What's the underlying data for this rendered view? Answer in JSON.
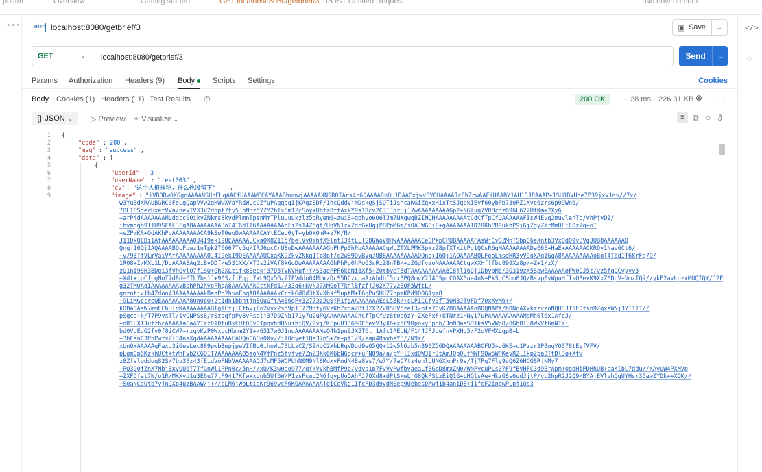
{
  "app": {
    "tab_strip": [
      "postm",
      "Overview",
      "Getting started",
      "GET localhost:8080/getbrief/3",
      "POST Untitled Request",
      "No environment"
    ]
  },
  "request": {
    "badge": "HTTP",
    "title": "localhost:8080/getbrief/3",
    "save_label": "Save",
    "method": "GET",
    "url": "localhost:8080/getbrief/3",
    "send_label": "Send"
  },
  "request_tabs": {
    "params": "Params",
    "authorization": "Authorization",
    "headers": "Headers (9)",
    "body": "Body",
    "scripts": "Scripts",
    "settings": "Settings",
    "cookies": "Cookies"
  },
  "response_tabs": {
    "body": "Body",
    "cookies": "Cookies (1)",
    "headers": "Headers (11)",
    "test_results": "Test Results"
  },
  "response_meta": {
    "status": "200 OK",
    "time": "28 ms",
    "size": "226.31 KB"
  },
  "format_bar": {
    "format": "JSON",
    "preview": "Preview",
    "visualize": "Visualize"
  },
  "icons": {
    "left_menu": "more-dots-icon",
    "right_code": "code-icon",
    "right_bulb": "lightbulb-icon",
    "history": "history-icon",
    "globe": "globe-icon",
    "wrap": "wrap-lines-icon",
    "copy": "copy-icon",
    "search": "search-icon",
    "link": "link-icon"
  },
  "colors": {
    "accent": "#2871d4",
    "method_get": "#0b7a3e",
    "status_ok_bg": "#e4f3e7",
    "json_key": "#b0382f",
    "json_value": "#0b5fb8"
  },
  "code": {
    "line_numbers": [
      "1",
      "2",
      "3",
      "4",
      "5",
      "6",
      "7",
      "8",
      "9"
    ],
    "l1": "{",
    "l2_key": "\"code\"",
    "l2_val": "200",
    "l3_key": "\"msg\"",
    "l3_val": "\"success\"",
    "l4_key": "\"data\"",
    "l4_open": "[",
    "l5": "{",
    "l6_key": "\"userId\"",
    "l6_val": "3",
    "l7_key": "\"userName\"",
    "l7_val": "\"test003\"",
    "l8_key": "\"cv\"",
    "l8_val": "\"这个人很神秘，什么也没留下\"",
    "l9_key": "\"image\"",
    "l9_first": "\"iVBORw0KGgoAAAANSUhEUgAACfUAAAWECAYAAABhunwjAAAAAXNSR0IArs4c6QAAAARnQU1BAACxjwv8YQUAAAAJcEhZcwAAFiUAABY1AU1SJPAAAP+1SURBVHhe7P39jxV1nv//7x/",
    "image_lines": [
      "w3YuBdXRAUBGRC0FoLgQapVVw2gHWwXVaYRdWUcCZfuPAggsqIjKAgzSDF/1hcQddVjNDskQSjSQTiJshcaKGiZgxxHixTtSJgbkIEyf60ybPb730RZ1Xvc6zrs6p09Wn6/",
      "7DLTPSderUxetVVa/neVTVX3V2dopt7ty5JbNnz5YZM2bIxEmTZcSoy+Ubfz8tfAxkY9s1Rcv2CJTJqzHj17wAAAAAAAAAGp2+NGluq7V08coz696L622HfKm+2Xy6",
      "+arP4dAAAAAAAMLddcc00ikyZNkms8kydPlmnTpsnMmTPluuuukzlz5pRyem6+zwiE+qphvo6O6TJm7NXqwgBZINQHAAAAAAAAAtCdCfTpCfQAAAAAAFIsW4Evq2muvlenTp/vhPjvDZ/",
      "ihvmqgb9I1U9SFALJEqA8AAAAAAAABoT4T6dIT6AAAAAAAAoFi2s14Z5gt/UqVN1zxZdcG+UqjPBPpM6m/s0AJWGBiE+gAAAAAAAID2RKhPR9ukhP9j6jZgyZYrMmDEjEOz7q+oT",
      "+sZPmKR+OdAKhPoAAAAAAAACA9kSoT0eoDwAAAAACAYtECeo0yT+ybOXOmR+z7K/N/",
      "J11DkQEDi1AfAAAAAAAAA0J4I9ek19QEAAAAAUCxaOK8Z1157belVv0YhfX9lntI34tLLlS8GWoVQHwAAAAAAACeCPXpCPUBAAAAAFAsWjCvGZMnTSbp06eXntb3Vx0d09vBVqJUB8AAAAAAD",
      "Qngj16Qj1AQAAAABQLFowz1nTpk2T6667Tv5q/IRJ6pcCrUSoDwAAAAAAAAGhPhPp0hPoAAAAAACgWLZTXLPMK3pkzZ8pfXTxitPq1QCsR6gMAAAAAAAADaE6E+HaE+AAAAAACKRQv1Nav6Ct6/",
      "+v/93TfVLmVaiVAfAAAAAAAAA0J4I9ekI9QEAAAAAUCxaKK9ZkyZNkq1Tp8pf/c2wS9QvBVqJUB8AAAAAAAAADQngj16Qj1AQAAAABQLFooLmsdHR3yV9oXAq1GqA8AAAAAAAAAoBoT4T6dIT68rFq7Q/",
      "1R08+I/MXL1L/DgAAAABAq2iBvDDf/e531XX/XTJs2iVAf8kGoDwAAAAAAAAGhPhPp0hPoG3sRzZ8nTB/+zZGdfvzoNAAAAAACtqwXXHfffbc899Xz8p/+Z+1/zX/",
      "zU1nI9SH3BDqi3fVhGvlO7f1SO+Gh2XLtifk8Seekj37D5YVKVHuf+Y/S3aePPP6kbNi8Xf5+Z0tbyeT8dTAAAAAAAAAABI8jl16Qj1DbypM6/3Q319zX5SpwEAAAAAoFW0QJ5t/vz5fqQCvyvy3",
      "+Xdt+ipCfcgNoT7dRd+6TL7bs1J+90SzfjEqjb7+L9Qx5GzfIFVddo84MUmzDcS5DCzvcaAxAbdbI5rx3PQ8mvY2J4DSpcCQAX0ue4nN+PkSgCSbm8JQ/Bsvp0yWpuHfIsQ3evK9XxZ0DpV+VmzIQi//ykE2avLpzxMUQIQY/J2FnOs7w",
      "g32TMOAqIAAAAAAAAyBahPh2hvoFhqA8AAAAAAkCctkFd1//33q6+KvN37XMGoT7khlBfzfjJ02X77v2BQF5WftL/",
      "gnzntjv1b4Zdon43AAAAAAAAkBahPh2hvoFhqA8AAAAAAkCctkGd0d3tXvXbXf5uptM+T6gPuSHUZ7bpmKPd90OG1yz8",
      "+9LiMGccreQEAAAAAAAA8Qn06Q+2t1dn1bbntjn8OuGftA4E6qPv32773zJu0jR1fgAAAAAAAAEsL5Bk/+cLP1CCfy0fT5QH3JT9FDf70xXyM6+/",
      "kDBaSAsW7mmFCbUlgKAAAAAAAABIgICfjlCfbvjFo2Vyx2s59p1T7ZMnty6VzKhZxdaZBtJZX2ZvRSHV6ze13/ota70yKYB8AAAAAoB0QNAPf/hDNcAXxkzzvzoNQH3JT5FDfsn9ZqxaWNj3YI111//",
      "pSgcq+k/T7P9ysTl/1yONPSs8/r0zqgfpPv8vRselj37D9ZNb171y7u2uPQAAAAAAAAChCfTpCfUz8t0s6zY+ZXeFxF+kTNrz1HNy17uPAAAAAAAAAAMsMh0l6x1AfcJ/",
      "+dR1LXTJutzhcAAAAAaGa4YTzz010tuBxEHf0Qv0TpqvhdUNuihjQV/9vj/KFpuU33690E6evV3yX6+x5C9RpokyBpdb/JmN8aaSD1ksV5VWp8/0Gh8IU8WxVtGmNTzi",
      "bd0VqEdG2fv0f8iCW7+rzqvKzP0WxbcHbmm2Y1+/6517w0J1ngAAAAAAAMsO4h1pn9JX5T6tj1Afc1PEUN/F144JFJgefnyPXHp5/F2oVFMXLgpB+b",
      "+3bFenC3PnPwfvZl34naXqdAAAAAAAAAEAUQn06Qn0Xy//jI0oyef1Qe37pS+Zm+pf1/9/zap48mybeY8//N9z/",
      "xUnQYAAAAAgFaxg3iGeeLec889pwb3mpjpeVIfBo0ihoWL73LLzCZ/SZ4qC2XhLRgVDgd9eO5QQ+12w5l6zb5n390Z56DQAAAAAAAABCFUJ+u6KE+c1Pzzr3PBmqYO378tEyfVFV/",
      "pLgm0p6KzkhUCt+tWnFvb2C6OIT7AAAAAAAB5soN4VfPnz5fvfve7ZnZ3Xk6K6bN6qcr+uPN89a/a/pYHlIxdDW3IrJtAmJQp0ufMNF9Qw5WPKeyR2lIkp2pa3TtDl3q+Xtw",
      "z8Zfsloddoq82S/7bv3Bz43fEidVoFNbVAAAAAAQJ7cMF5WCPUhN0M9Nl8MdxvFmdN4Ba8Vs7/w7Y/7aC7tz4enlbUN6XkmPr9s/Tj7Pg7Fly9uQ6Z6HCGSRjNMy7",
      "+RQ390jZnX7NbjBxvUU6T7TfGnWl1PPn0c/5nH//xU/K3w0eo977/qY+VVkhBMfP9b/ydvq1p7FyVyPwfbvaeaLfBGcD8mxZN0/WNPycuPLs07F9fBVHFC3d9BrApm+0gdHiPDHhUB+aaKlbL7ddu//XAyuW4PXMVp",
      "+ZXFDfat7N/o1R/MKXvd1u3E6u77tF9417Kfw+xUnb5Uf6W/P1zsFcmq2N6fqypUoOAhFJ7OXd8+dPtSkwLrG8QkPSLzEiQ1G+LHQlsAe+HkzGSs6udJjtP/vc2hpR2J2Q9/BYAjEVlvhQgUYHsr35awZYDk++XQK//",
      "+S0aNCdQtb7vjn9Xp4uzBAAW/j+//cLM6jWbLtidKr969vcF6KQAAAAAAAjdICeVkg1IfcFD3d9ydNSep9UebesDAwj1b4aniDE+i1fcF2inpwPLpj1Qs3"
    ]
  }
}
